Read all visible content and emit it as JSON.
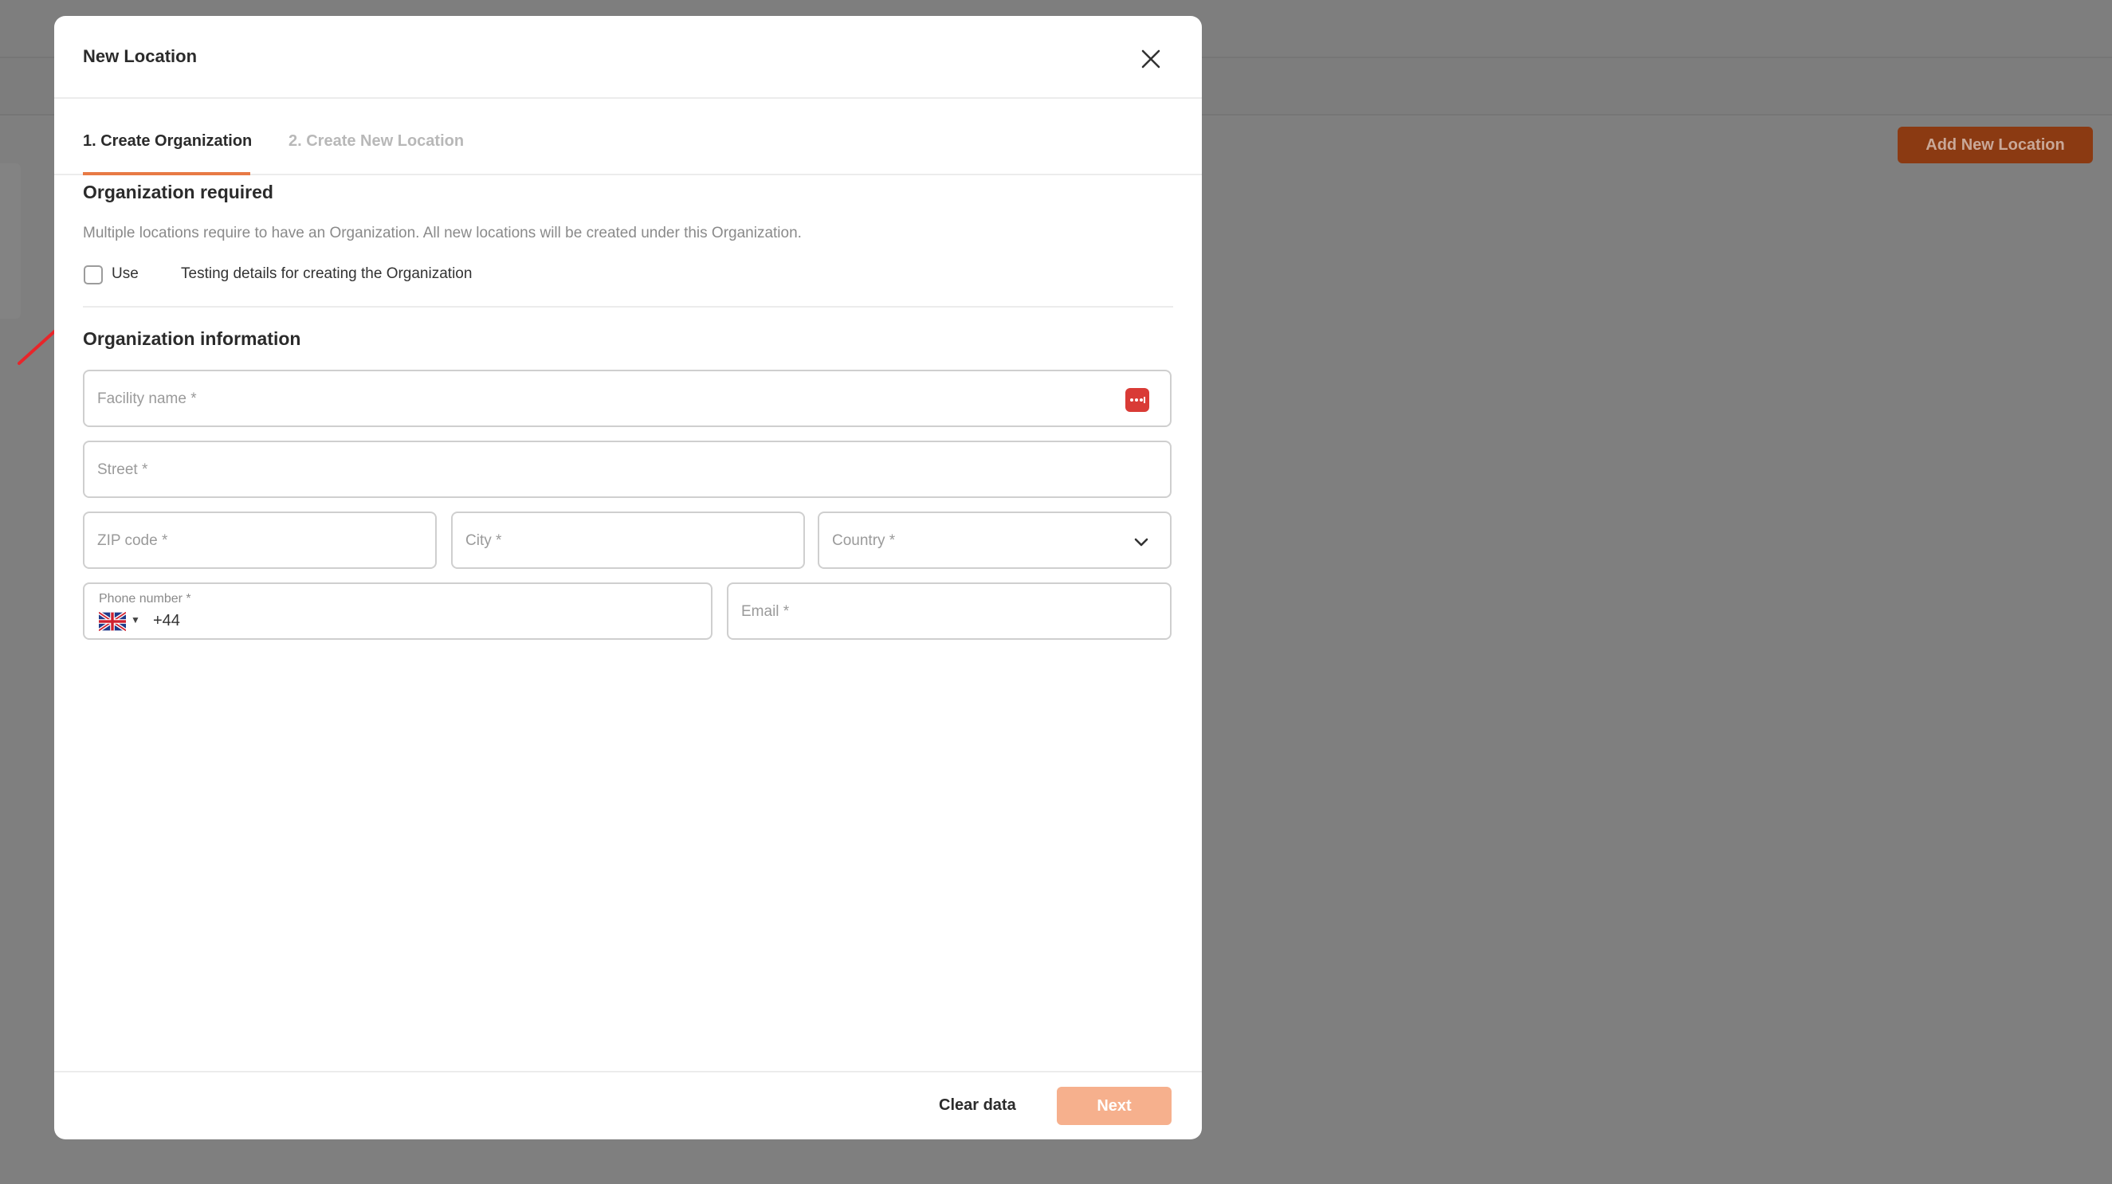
{
  "background": {
    "add_button_label": "Add New Location"
  },
  "modal": {
    "title": "New Location",
    "close_icon": "close-icon",
    "tabs": [
      {
        "label": "1. Create Organization",
        "active": true
      },
      {
        "label": "2. Create New Location",
        "active": false
      }
    ],
    "org_required": {
      "title": "Organization required",
      "description": "Multiple locations require to have an Organization. All new locations will be created under this Organization.",
      "checkbox_checked": false,
      "use_label": "Use",
      "use_detail": "Testing details for creating the Organization"
    },
    "org_info": {
      "title": "Organization information",
      "facility_placeholder": "Facility name *",
      "street_placeholder": "Street *",
      "zip_placeholder": "ZIP code *",
      "city_placeholder": "City *",
      "country_placeholder": "Country *",
      "phone_label": "Phone number *",
      "phone_value": "+44",
      "phone_flag": "uk-flag-icon",
      "email_placeholder": "Email *"
    },
    "footer": {
      "clear_label": "Clear data",
      "next_label": "Next"
    }
  },
  "colors": {
    "accent": "#e87a45",
    "next_disabled": "#f6b08d",
    "annotation_arrow": "#e8252a"
  }
}
